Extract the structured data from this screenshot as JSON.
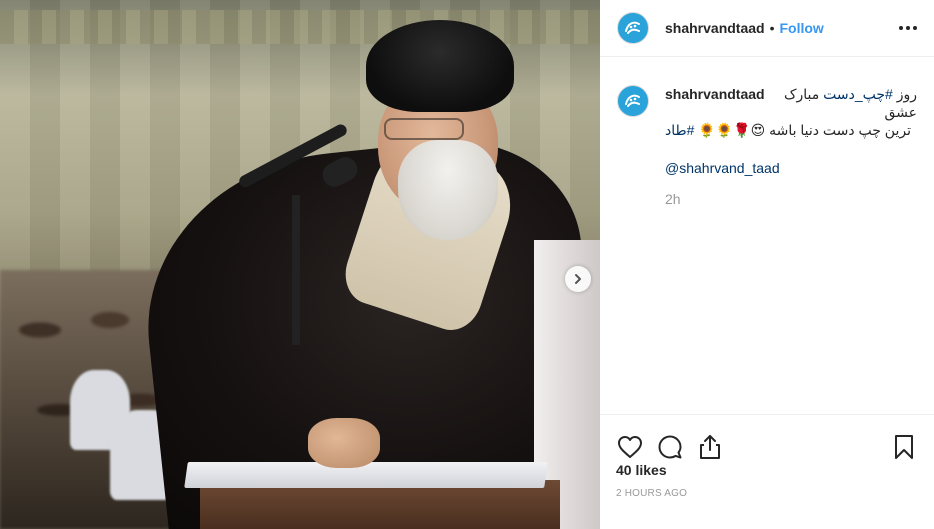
{
  "header": {
    "username": "shahrvandtaad",
    "separator": "•",
    "follow_label": "Follow"
  },
  "avatar": {
    "bg_color": "#29a3d9",
    "icon": "shahrvand-logo"
  },
  "caption": {
    "username": "shahrvandtaad",
    "line1_prefix": "روز ",
    "line1_hashtag": "#چپ_دست",
    "line1_suffix": " مبارک عشق",
    "line2_text": "ترین چپ دست دنیا باشه 😍🌹🌻🌻 ",
    "line2_hashtag": "#طاد",
    "mention": "@shahrvand_taad",
    "time": "2h"
  },
  "actions": {
    "like_icon": "heart-icon",
    "comment_icon": "comment-icon",
    "share_icon": "share-icon",
    "save_icon": "bookmark-icon"
  },
  "stats": {
    "likes": "40 likes",
    "date": "2 HOURS AGO"
  },
  "colors": {
    "link": "#3897f0",
    "hashtag": "#003569",
    "muted": "#999999",
    "divider": "#efefef"
  }
}
